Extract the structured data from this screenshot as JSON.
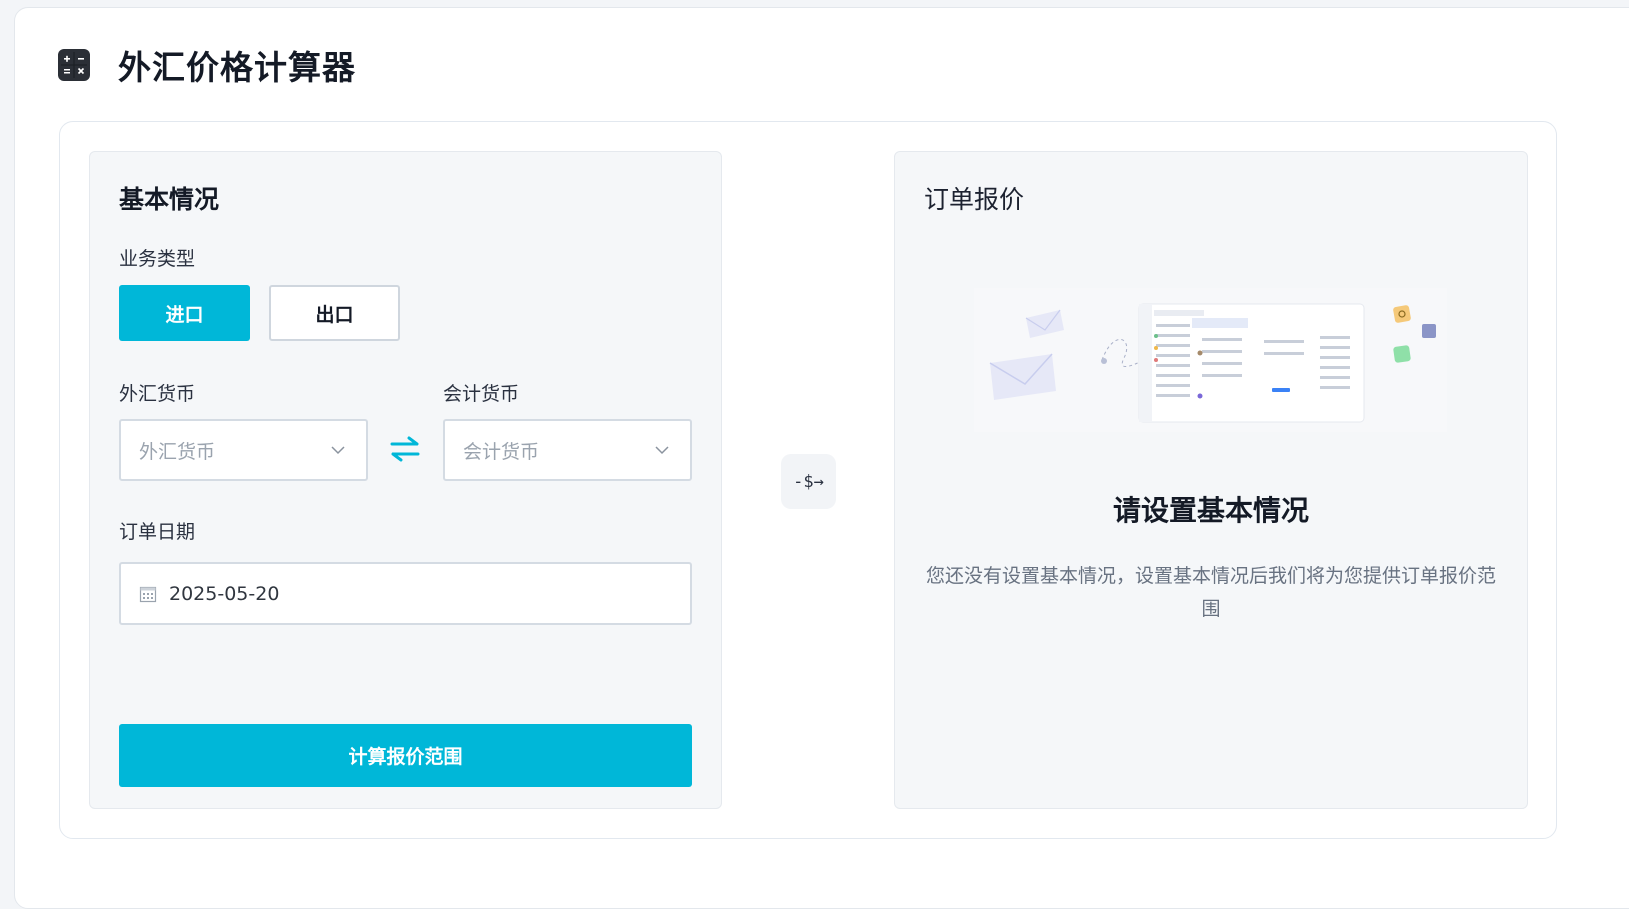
{
  "header": {
    "title": "外汇价格计算器",
    "icon": "calculator-icon"
  },
  "basic": {
    "title": "基本情况",
    "business_type_label": "业务类型",
    "import_label": "进口",
    "export_label": "出口",
    "fx_currency_label": "外汇货币",
    "fx_currency_placeholder": "外汇货币",
    "acc_currency_label": "会计货币",
    "acc_currency_placeholder": "会计货币",
    "order_date_label": "订单日期",
    "order_date_value": "2025-05-20",
    "calculate_label": "计算报价范围"
  },
  "middle": {
    "icon_text": "-$→"
  },
  "quote": {
    "title": "订单报价",
    "empty_title": "请设置基本情况",
    "empty_desc": "您还没有设置基本情况，设置基本情况后我们将为您提供订单报价范围"
  },
  "colors": {
    "accent": "#00b7d8",
    "card_bg": "#f5f7f9"
  }
}
